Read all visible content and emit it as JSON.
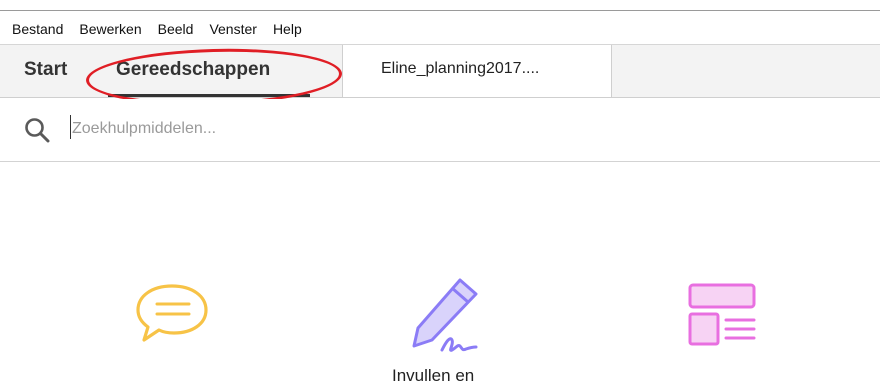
{
  "menubar": {
    "items": [
      "Bestand",
      "Bewerken",
      "Beeld",
      "Venster",
      "Help"
    ]
  },
  "tabs": {
    "start": "Start",
    "tools": "Gereedschappen",
    "document": "Eline_planning2017...."
  },
  "search": {
    "placeholder": "Zoekhulpmiddelen..."
  },
  "tools": {
    "comment": {
      "icon": "comment-icon",
      "color": "#f7c347"
    },
    "fill_sign": {
      "icon": "fill-sign-pen-icon",
      "color": "#8b7cf6",
      "label": "Invullen en"
    },
    "organize": {
      "icon": "organize-pages-icon",
      "color": "#e86fe0"
    }
  },
  "colors": {
    "annotation_red": "#e01e25"
  }
}
